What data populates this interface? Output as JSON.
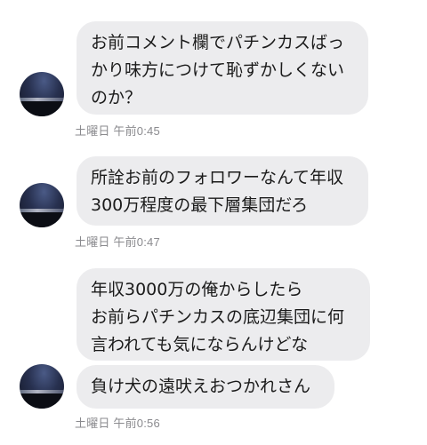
{
  "conversation": {
    "groups": [
      {
        "messages": [
          "お前コメント欄でパチンカスばっ\nかり味方につけて恥ずかしくない\nのか？"
        ],
        "timestamp": "土曜日 午前0:45"
      },
      {
        "messages": [
          "所詮お前のフォロワーなんて年収\n300万程度の最下層集団だろ"
        ],
        "timestamp": "土曜日 午前0:47"
      },
      {
        "messages": [
          "年収3000万の俺からしたら\nお前らパチンカスの底辺集団に何\n言われても気にならんけどな",
          "負け犬の遠吠えおつかれさん"
        ],
        "timestamp": "土曜日 午前0:56"
      }
    ]
  }
}
